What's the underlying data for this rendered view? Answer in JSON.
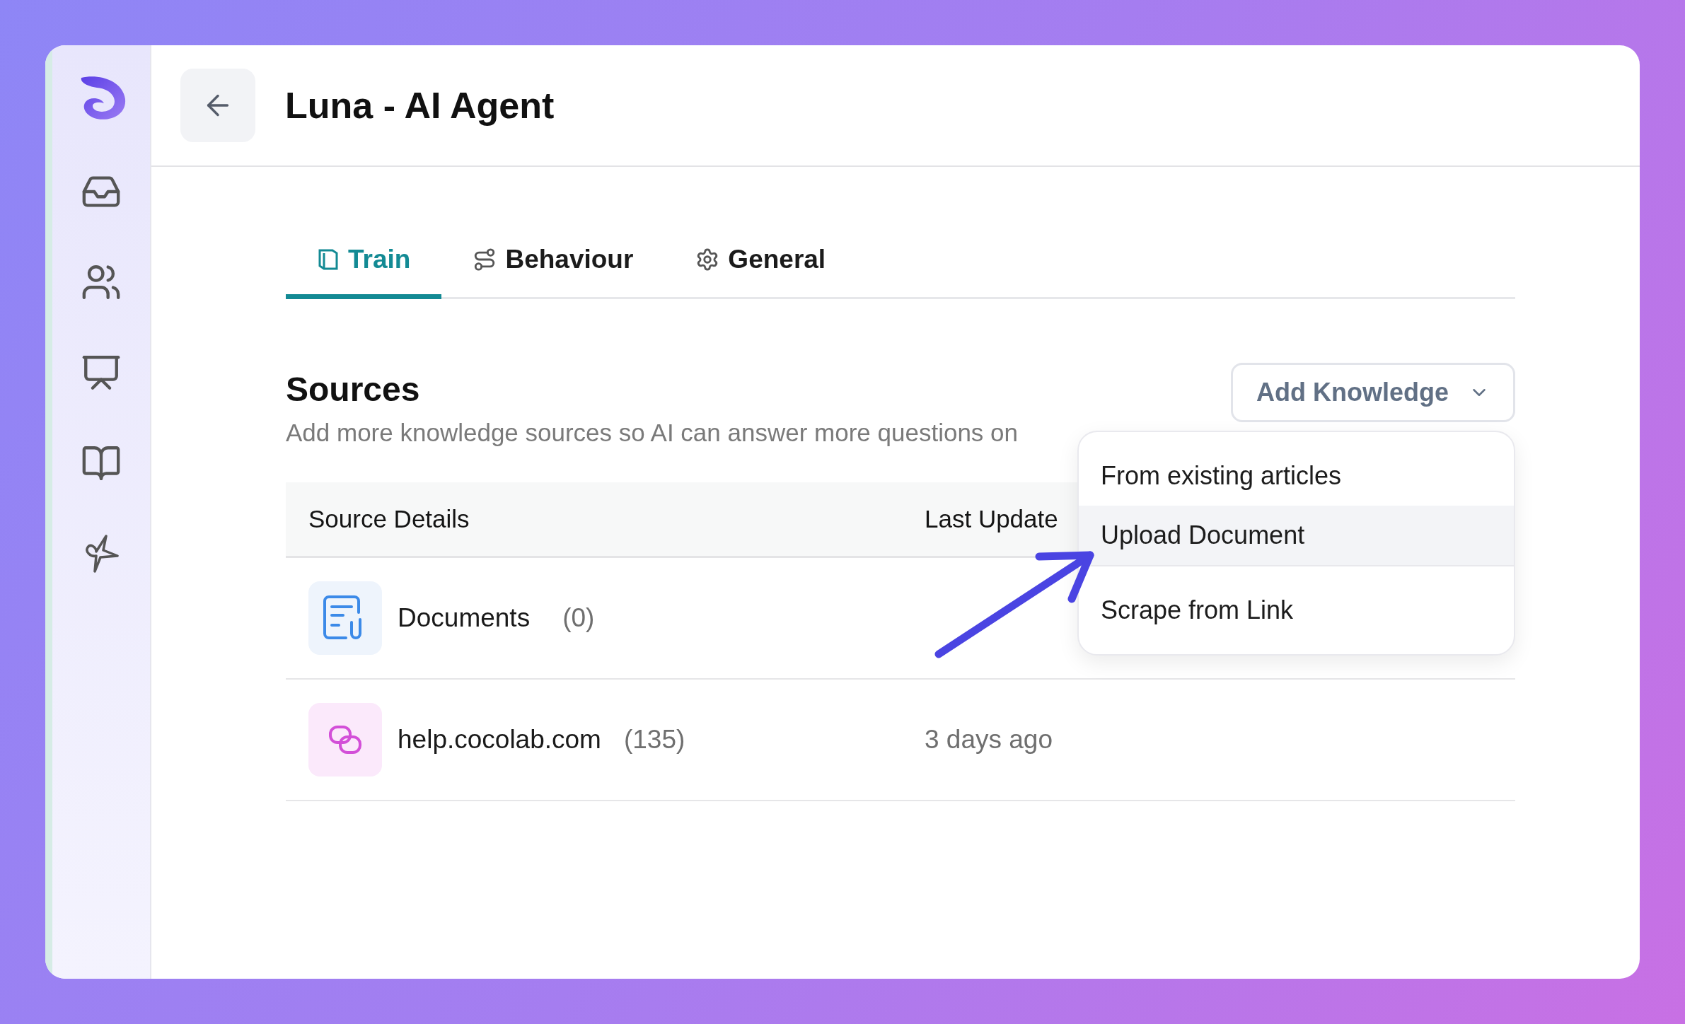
{
  "header": {
    "title": "Luna - AI Agent"
  },
  "tabs": [
    {
      "label": "Train",
      "kind": "train",
      "selected": true
    },
    {
      "label": "Behaviour",
      "kind": "behaviour",
      "selected": false
    },
    {
      "label": "General",
      "kind": "general",
      "selected": false
    }
  ],
  "sources": {
    "title": "Sources",
    "subtitle": "Add more knowledge sources so AI can answer more questions on",
    "add_button": "Add Knowledge",
    "menu": [
      {
        "label": "From existing articles",
        "selected": false
      },
      {
        "label": "Upload Document",
        "selected": true
      },
      {
        "label": "Scrape from Link",
        "selected": false
      }
    ]
  },
  "table": {
    "columns": [
      "Source Details",
      "Last Update"
    ],
    "rows": [
      {
        "kind": "documents",
        "name": "Documents",
        "count": "(0)"
      },
      {
        "kind": "link",
        "name": "help.cocolab.com",
        "count": "(135)",
        "updated": "3 days ago"
      }
    ]
  }
}
